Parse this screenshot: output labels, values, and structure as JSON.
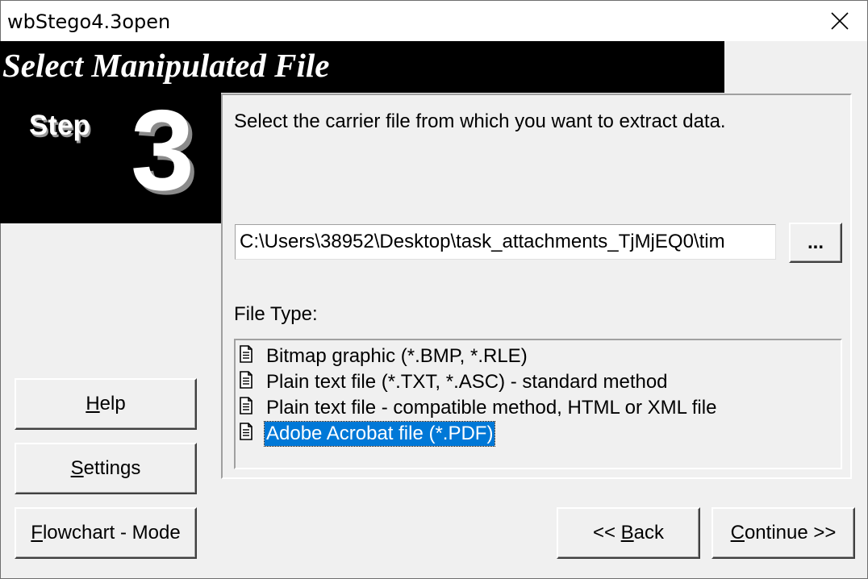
{
  "window": {
    "title": "wbStego4.3open"
  },
  "header": {
    "title": "Select Manipulated File",
    "step_word": "Step",
    "step_number": "3"
  },
  "panel": {
    "instruction": "Select the carrier file from which you want to extract data.",
    "file_path": "C:\\Users\\38952\\Desktop\\task_attachments_TjMjEQ0\\tim",
    "browse_label": "...",
    "file_type_label": "File Type:",
    "file_types": [
      {
        "label": "Bitmap graphic (*.BMP, *.RLE)",
        "icon": "document-icon",
        "selected": false
      },
      {
        "label": "Plain text file (*.TXT, *.ASC) - standard method",
        "icon": "document-icon",
        "selected": false
      },
      {
        "label": "Plain text file - compatible method, HTML or XML file",
        "icon": "document-icon",
        "selected": false
      },
      {
        "label": "Adobe Acrobat file (*.PDF)",
        "icon": "document-icon",
        "selected": true
      }
    ]
  },
  "buttons": {
    "help": {
      "mnemonic": "H",
      "rest": "elp"
    },
    "settings": {
      "mnemonic": "S",
      "rest": "ettings"
    },
    "flowchart": {
      "mnemonic": "F",
      "rest": "lowchart - Mode"
    },
    "back": {
      "prefix": "<< ",
      "mnemonic": "B",
      "rest": "ack"
    },
    "continue": {
      "mnemonic": "C",
      "rest": "ontinue >>"
    }
  },
  "colors": {
    "selection": "#0078d7",
    "header_background": "#000000",
    "window_background": "#f0f0f0"
  }
}
